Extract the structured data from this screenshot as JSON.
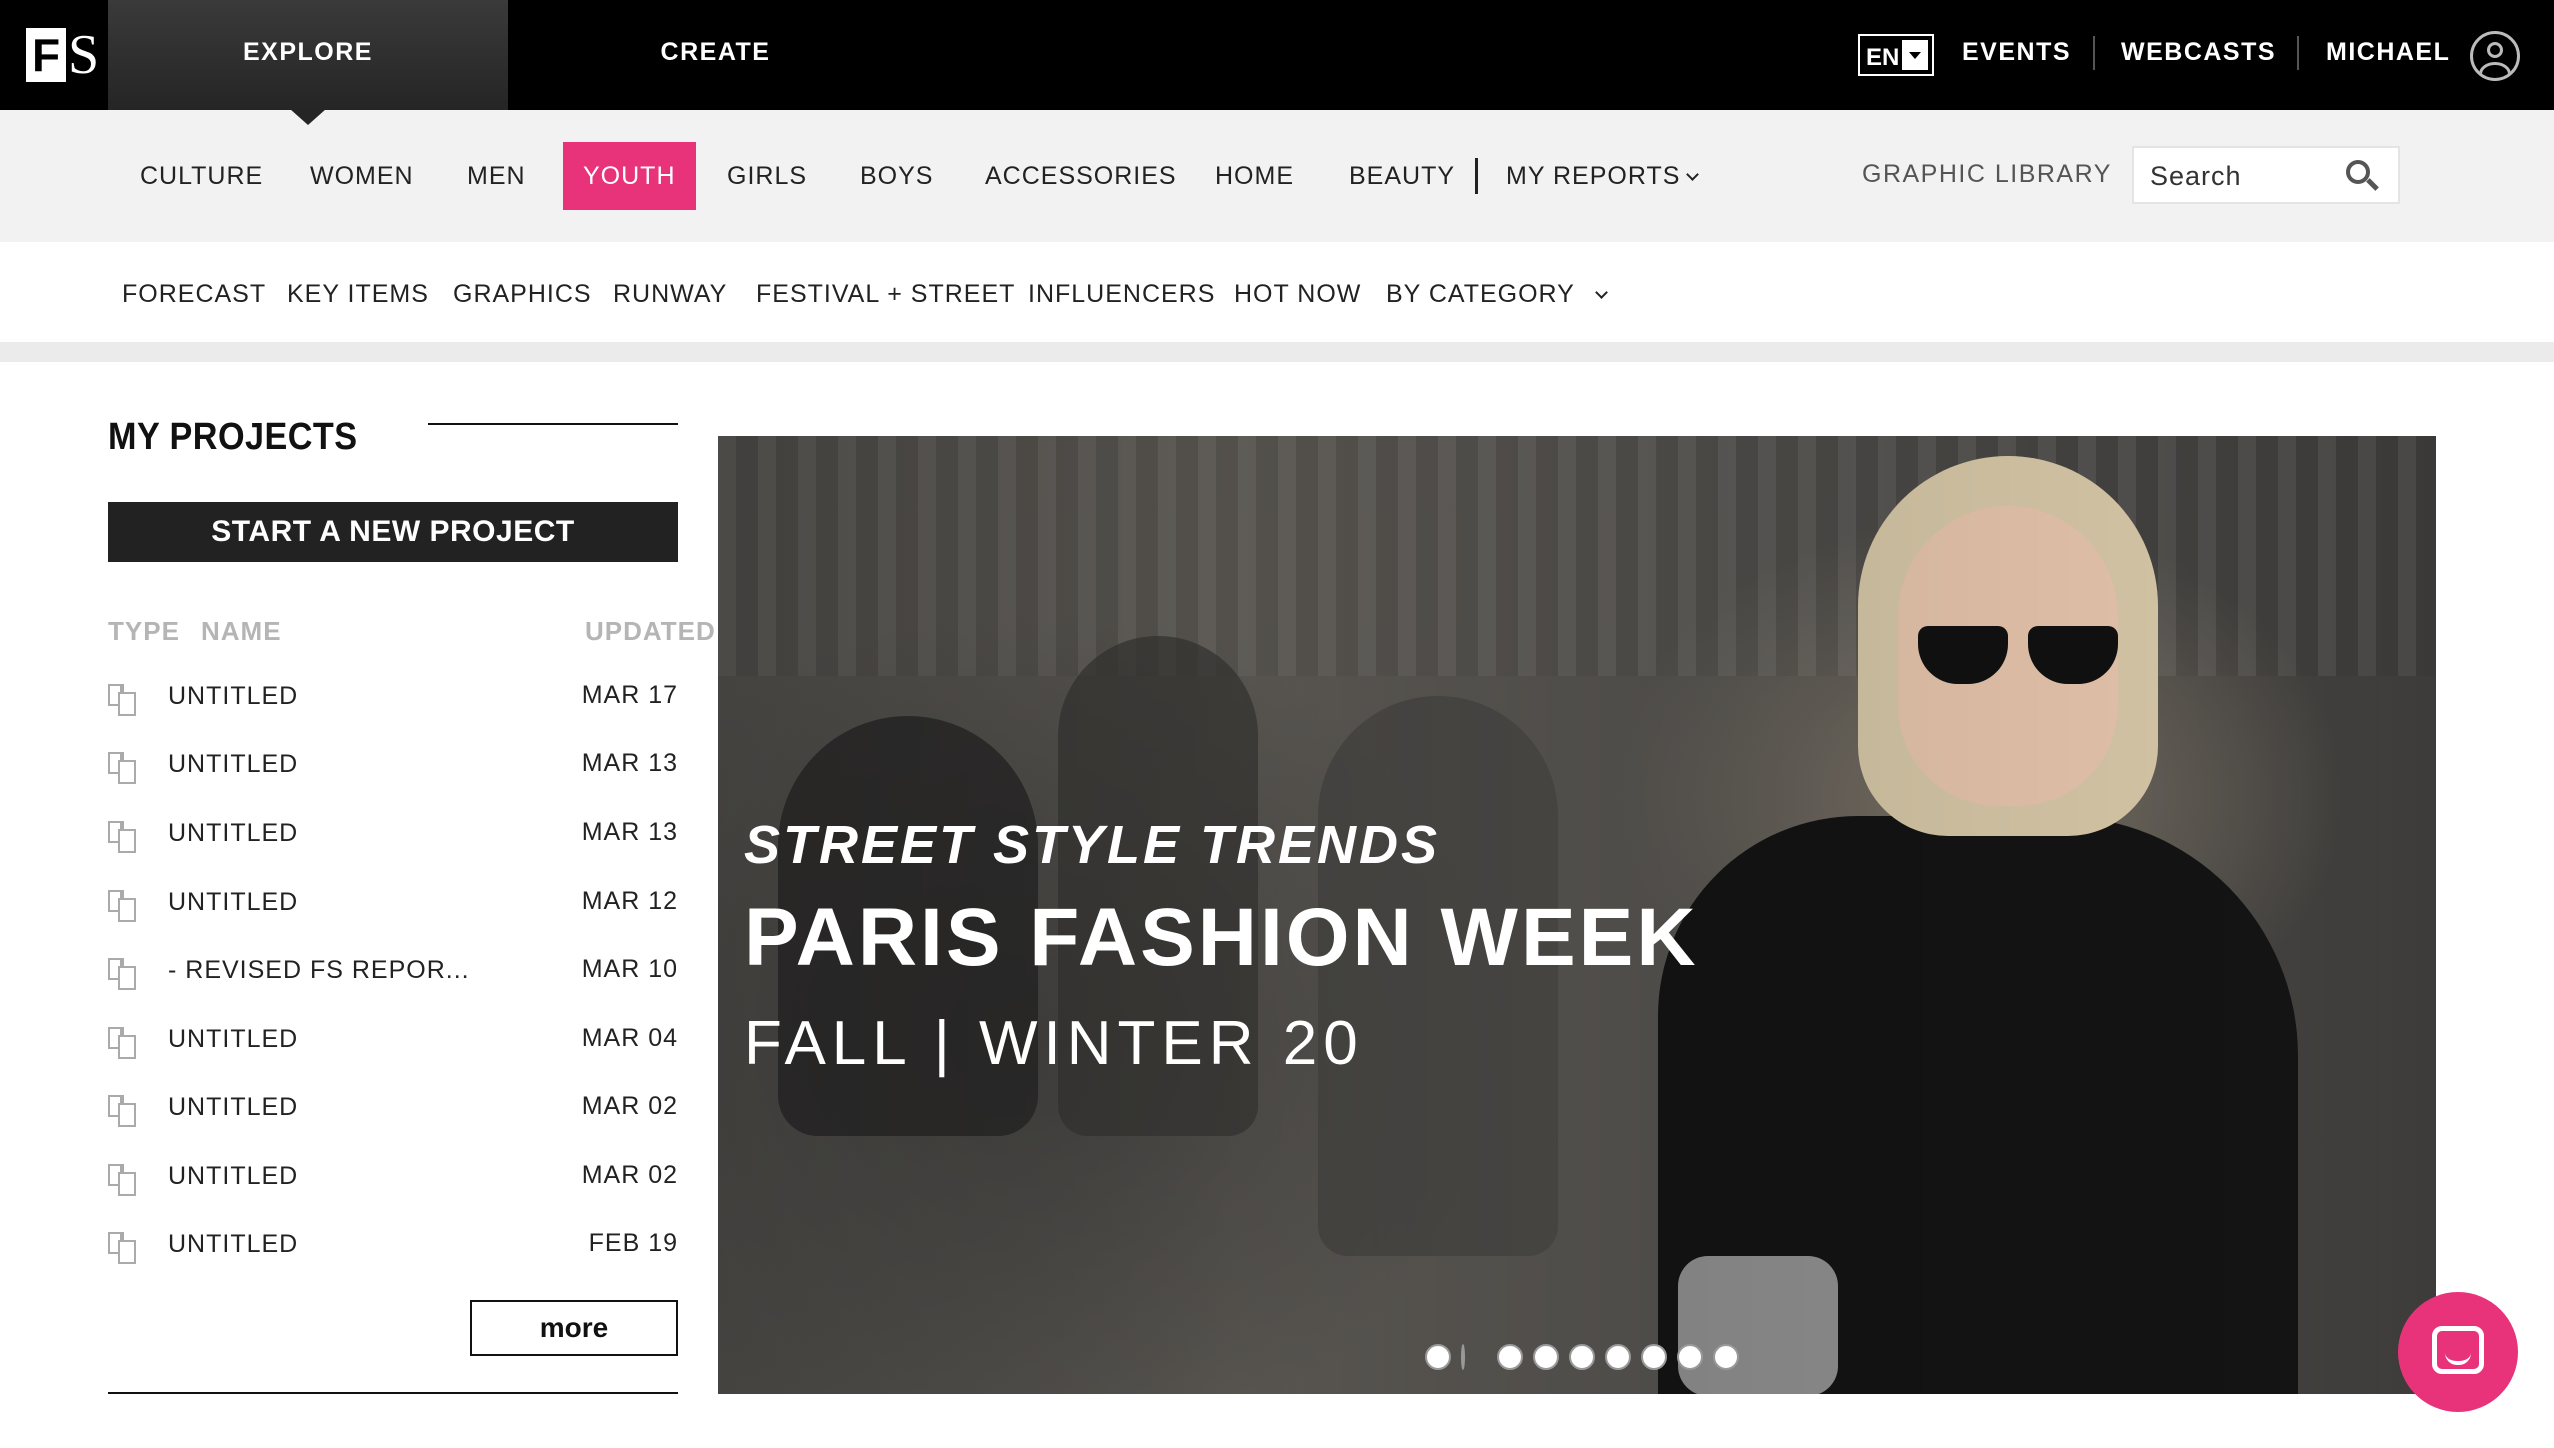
{
  "brand": {
    "logo_mark": "FS"
  },
  "topbar": {
    "tabs": [
      {
        "label": "EXPLORE"
      },
      {
        "label": "CREATE"
      }
    ],
    "language": "EN",
    "links": [
      {
        "label": "EVENTS"
      },
      {
        "label": "WEBCASTS"
      }
    ],
    "user_name": "MICHAEL"
  },
  "categories": {
    "items": [
      {
        "label": "CULTURE"
      },
      {
        "label": "WOMEN"
      },
      {
        "label": "MEN"
      },
      {
        "label": "YOUTH"
      },
      {
        "label": "GIRLS"
      },
      {
        "label": "BOYS"
      },
      {
        "label": "ACCESSORIES"
      },
      {
        "label": "HOME"
      },
      {
        "label": "BEAUTY"
      }
    ],
    "active": "YOUTH",
    "my_reports": "MY REPORTS",
    "graphic_library": "GRAPHIC LIBRARY",
    "search_placeholder": "Search"
  },
  "subnav": {
    "items": [
      {
        "label": "FORECAST"
      },
      {
        "label": "KEY ITEMS"
      },
      {
        "label": "GRAPHICS"
      },
      {
        "label": "RUNWAY"
      },
      {
        "label": "FESTIVAL + STREET"
      },
      {
        "label": "INFLUENCERS"
      },
      {
        "label": "HOT NOW"
      }
    ],
    "by_category": "BY CATEGORY"
  },
  "projects": {
    "title": "MY PROJECTS",
    "new_button": "START A NEW PROJECT",
    "columns": {
      "type": "TYPE",
      "name": "NAME",
      "updated": "UPDATED"
    },
    "rows": [
      {
        "name": "UNTITLED",
        "date": "MAR 17"
      },
      {
        "name": "UNTITLED",
        "date": "MAR 13"
      },
      {
        "name": "UNTITLED",
        "date": "MAR 13"
      },
      {
        "name": "UNTITLED",
        "date": "MAR 12"
      },
      {
        "name": "- REVISED FS REPOR...",
        "date": "MAR 10"
      },
      {
        "name": "UNTITLED",
        "date": "MAR 04"
      },
      {
        "name": "UNTITLED",
        "date": "MAR 02"
      },
      {
        "name": "UNTITLED",
        "date": "MAR 02"
      },
      {
        "name": "UNTITLED",
        "date": "FEB 19"
      }
    ],
    "more_label": "more"
  },
  "hero": {
    "kicker": "STREET STYLE TRENDS",
    "title": "PARIS FASHION WEEK",
    "subtitle": "FALL | WINTER 20",
    "slide_count": 9,
    "active_slide": 1
  },
  "colors": {
    "accent": "#e8337a",
    "topbar": "#000000",
    "nav_bg": "#f2f2f2"
  },
  "icons": {
    "search": "search-icon",
    "user": "user-avatar-icon",
    "chat": "chat-icon",
    "project_type": "document-stack-icon"
  }
}
